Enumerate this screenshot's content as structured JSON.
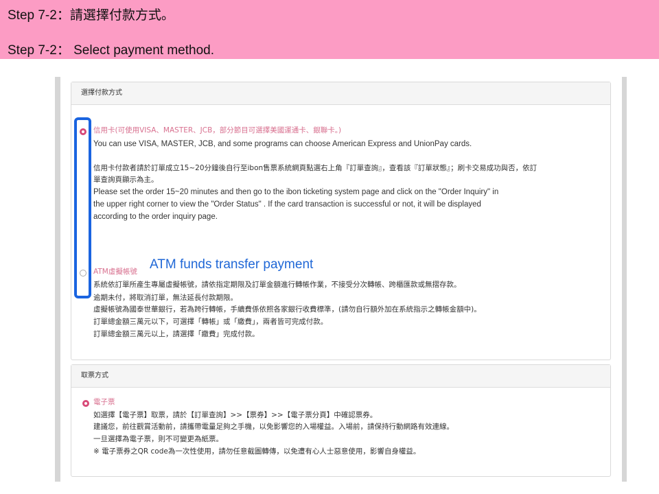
{
  "banner": {
    "line1": "Step 7-2：請選擇付款方式。",
    "line2": "Step 7-2： Select payment method."
  },
  "payment_section": {
    "title": "選擇付款方式",
    "credit_card": {
      "label": "信用卡(可使用VISA、MASTER、JCB，部分節目可選擇美國運通卡、銀聯卡。)",
      "label_en": "You can use VISA, MASTER, JCB, and some programs can choose American Express and UnionPay cards.",
      "note_zh_1": "信用卡付款者請於訂單成立15~20分鐘後自行至ibon售票系統網頁點選右上角『訂單查詢』，查看該『訂單狀態』；刷卡交易成功與否，依訂",
      "note_zh_2": "單查詢頁顯示為主。",
      "note_en_1": "Please set the order 15~20 minutes and then go to the ibon ticketing system page and click on the  \"Order Inquiry\"  in",
      "note_en_2": "the upper right corner to view the  \"Order Status\" . If the card transaction is successful or not, it will be displayed",
      "note_en_3": "according to the order inquiry page.",
      "selected": true
    },
    "atm": {
      "label": "ATM虛擬帳號",
      "callout": "ATM funds transfer payment",
      "lines": [
        "系統依訂單所產生專屬虛擬帳號，請依指定期限及訂單金額進行轉帳作業，不接受分次轉帳、跨櫃匯款或無摺存款。",
        "逾期未付，將取消訂單，無法延長付款期限。",
        "虛擬帳號為國泰世華銀行，若為跨行轉帳，手續費係依照各家銀行收費標準，(請勿自行額外加在系統指示之轉帳金額中)。",
        "訂單總金額三萬元以下，可選擇「轉帳」或「繳費」，兩者皆可完成付款。",
        "訂單總金額三萬元以上，請選擇「繳費」完成付款。"
      ],
      "selected": false
    }
  },
  "ticket_section": {
    "title": "取票方式",
    "eticket": {
      "label": "電子票",
      "lines": [
        "如選擇【電子票】取票，請於【訂單查詢】>>【票券】>>【電子票分頁】中確認票券。",
        "建議您，前往觀賞活動前，請攜帶電量足夠之手機，以免影響您的入場權益。入場前，請保持行動網路有效連線。",
        "一旦選擇為電子票，則不可變更為紙票。",
        "※ 電子票券之QR code為一次性使用，請勿任意截圖轉傳，以免遭有心人士惡意使用，影響自身權益。"
      ],
      "selected": true
    }
  },
  "colors": {
    "banner_bg": "#fc9cc4",
    "accent_pink": "#d84a78",
    "callout_blue": "#1f67d6",
    "highlight_blue": "#1a64e0"
  }
}
